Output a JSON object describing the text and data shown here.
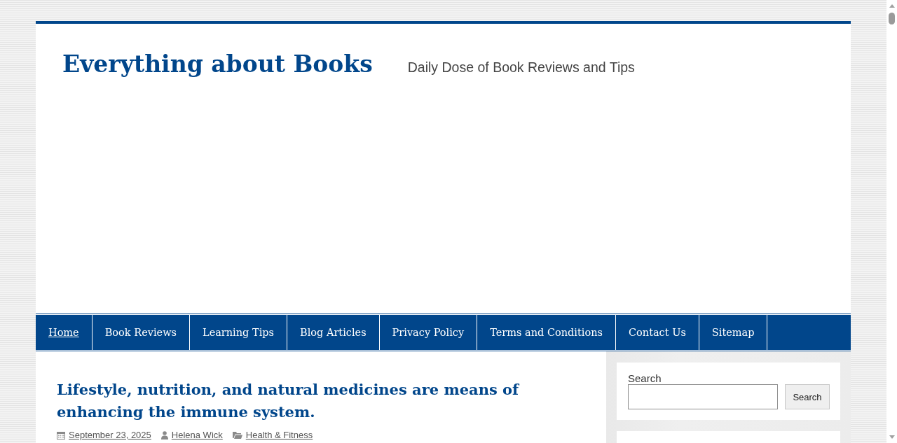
{
  "site": {
    "title": "Everything about Books",
    "tagline": "Daily Dose of Book Reviews and Tips"
  },
  "nav": {
    "items": [
      {
        "label": "Home",
        "selected": true
      },
      {
        "label": "Book Reviews",
        "selected": false
      },
      {
        "label": "Learning Tips",
        "selected": false
      },
      {
        "label": "Blog Articles",
        "selected": false
      },
      {
        "label": "Privacy Policy",
        "selected": false
      },
      {
        "label": "Terms and Conditions",
        "selected": false
      },
      {
        "label": "Contact Us",
        "selected": false
      },
      {
        "label": "Sitemap",
        "selected": false
      }
    ]
  },
  "post": {
    "title": "Lifestyle, nutrition, and natural medicines are means of enhancing the immune system.",
    "meta": [
      {
        "kind": "date",
        "text": "September 23, 2025"
      },
      {
        "kind": "author",
        "text": "Helena Wick"
      },
      {
        "kind": "category",
        "text": "Health & Fitness"
      }
    ]
  },
  "sidebar": {
    "widgets": [
      {
        "kind": "search",
        "label": "Search",
        "button": "Search"
      }
    ]
  }
}
